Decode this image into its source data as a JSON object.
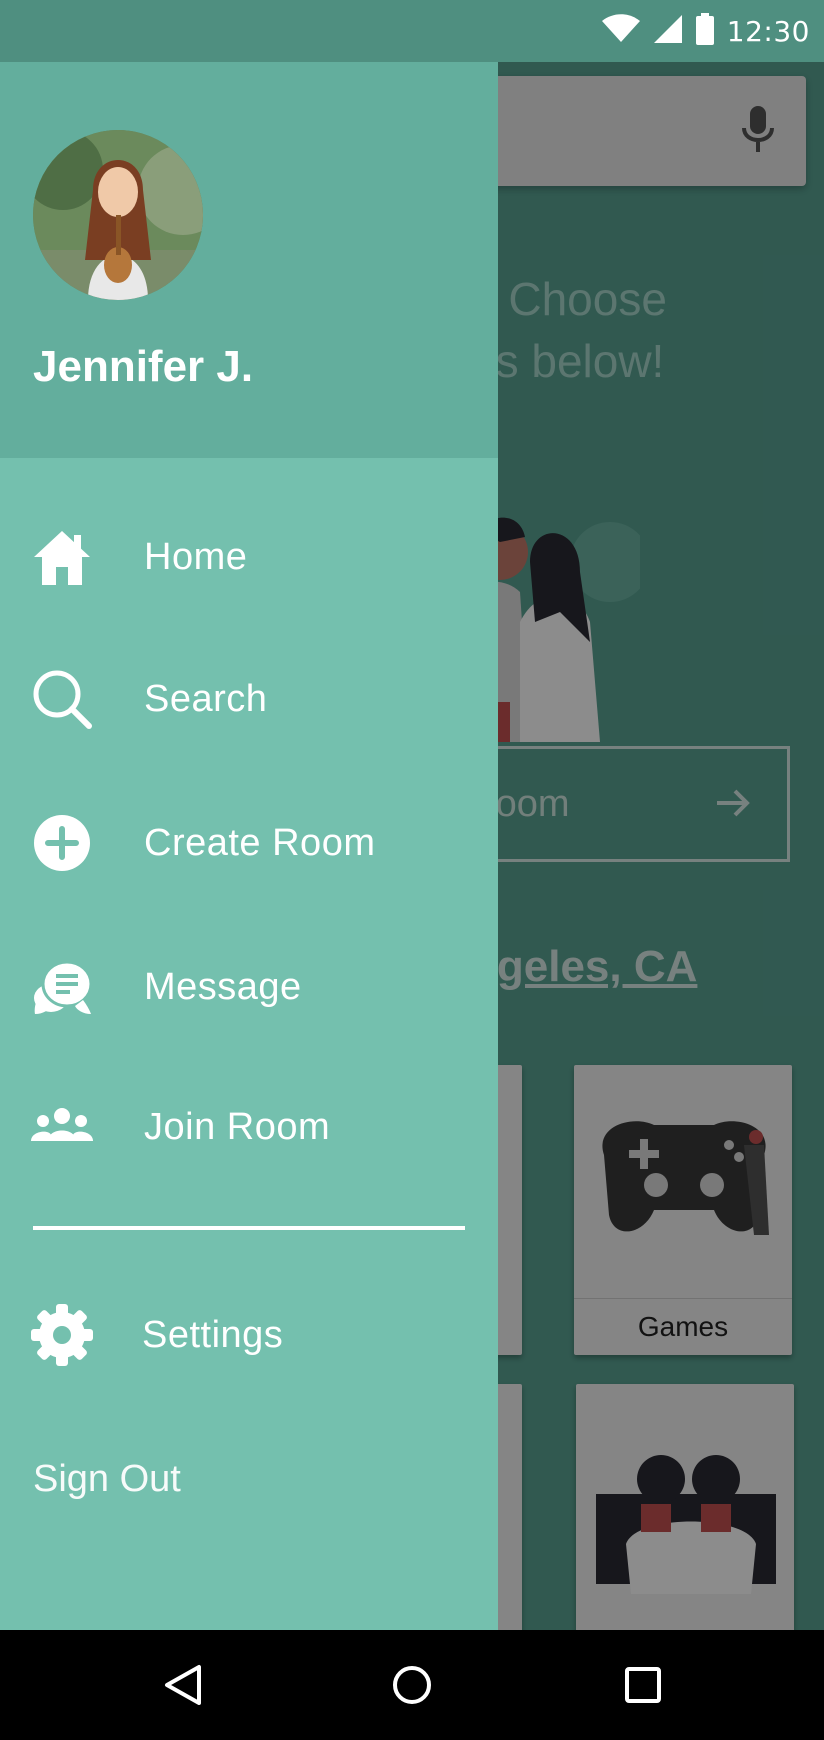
{
  "status_bar": {
    "time": "12:30",
    "icons": [
      "wifi-icon",
      "cell-signal-icon",
      "battery-icon"
    ]
  },
  "background": {
    "search": {
      "icon": "mic-icon"
    },
    "prompt_line_1": "? Choose",
    "prompt_line_2": "es below!",
    "room_input_text": "room",
    "location_text": "ngeles, CA",
    "cards": [
      {
        "label": "Games"
      }
    ]
  },
  "drawer": {
    "user_name": "Jennifer J.",
    "menu": [
      {
        "label": "Home",
        "icon": "home-icon"
      },
      {
        "label": "Search",
        "icon": "search-icon"
      },
      {
        "label": "Create Room",
        "icon": "add-circle-icon"
      },
      {
        "label": "Message",
        "icon": "message-icon"
      },
      {
        "label": "Join Room",
        "icon": "group-icon"
      }
    ],
    "settings": {
      "label": "Settings",
      "icon": "gear-icon"
    },
    "sign_out": "Sign Out"
  },
  "nav_bar": {
    "buttons": [
      "back-icon",
      "home-circle-icon",
      "recent-apps-icon"
    ]
  },
  "colors": {
    "drawer_bg": "#74c0ae",
    "drawer_header_bg": "#63ae9d",
    "status_bar_bg": "#4f8f80",
    "nav_bar_bg": "#000000",
    "text_white": "#ffffff"
  }
}
